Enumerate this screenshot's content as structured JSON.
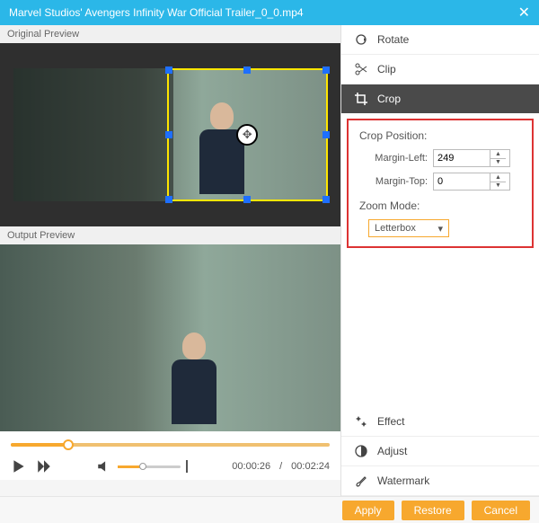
{
  "titlebar": {
    "title": "Marvel Studios' Avengers Infinity War Official Trailer_0_0.mp4"
  },
  "left": {
    "original_label": "Original Preview",
    "output_label": "Output Preview",
    "time_current": "00:00:26",
    "time_total": "00:02:24"
  },
  "menu": {
    "rotate": "Rotate",
    "clip": "Clip",
    "crop": "Crop",
    "effect": "Effect",
    "adjust": "Adjust",
    "watermark": "Watermark"
  },
  "crop": {
    "position_title": "Crop Position:",
    "margin_left_label": "Margin-Left:",
    "margin_left": "249",
    "margin_top_label": "Margin-Top:",
    "margin_top": "0",
    "zoom_title": "Zoom Mode:",
    "zoom_value": "Letterbox"
  },
  "footer": {
    "apply": "Apply",
    "restore": "Restore",
    "cancel": "Cancel"
  },
  "colors": {
    "accent": "#f7a82e",
    "titlebar": "#2bb7e8",
    "highlight_border": "#d33"
  }
}
